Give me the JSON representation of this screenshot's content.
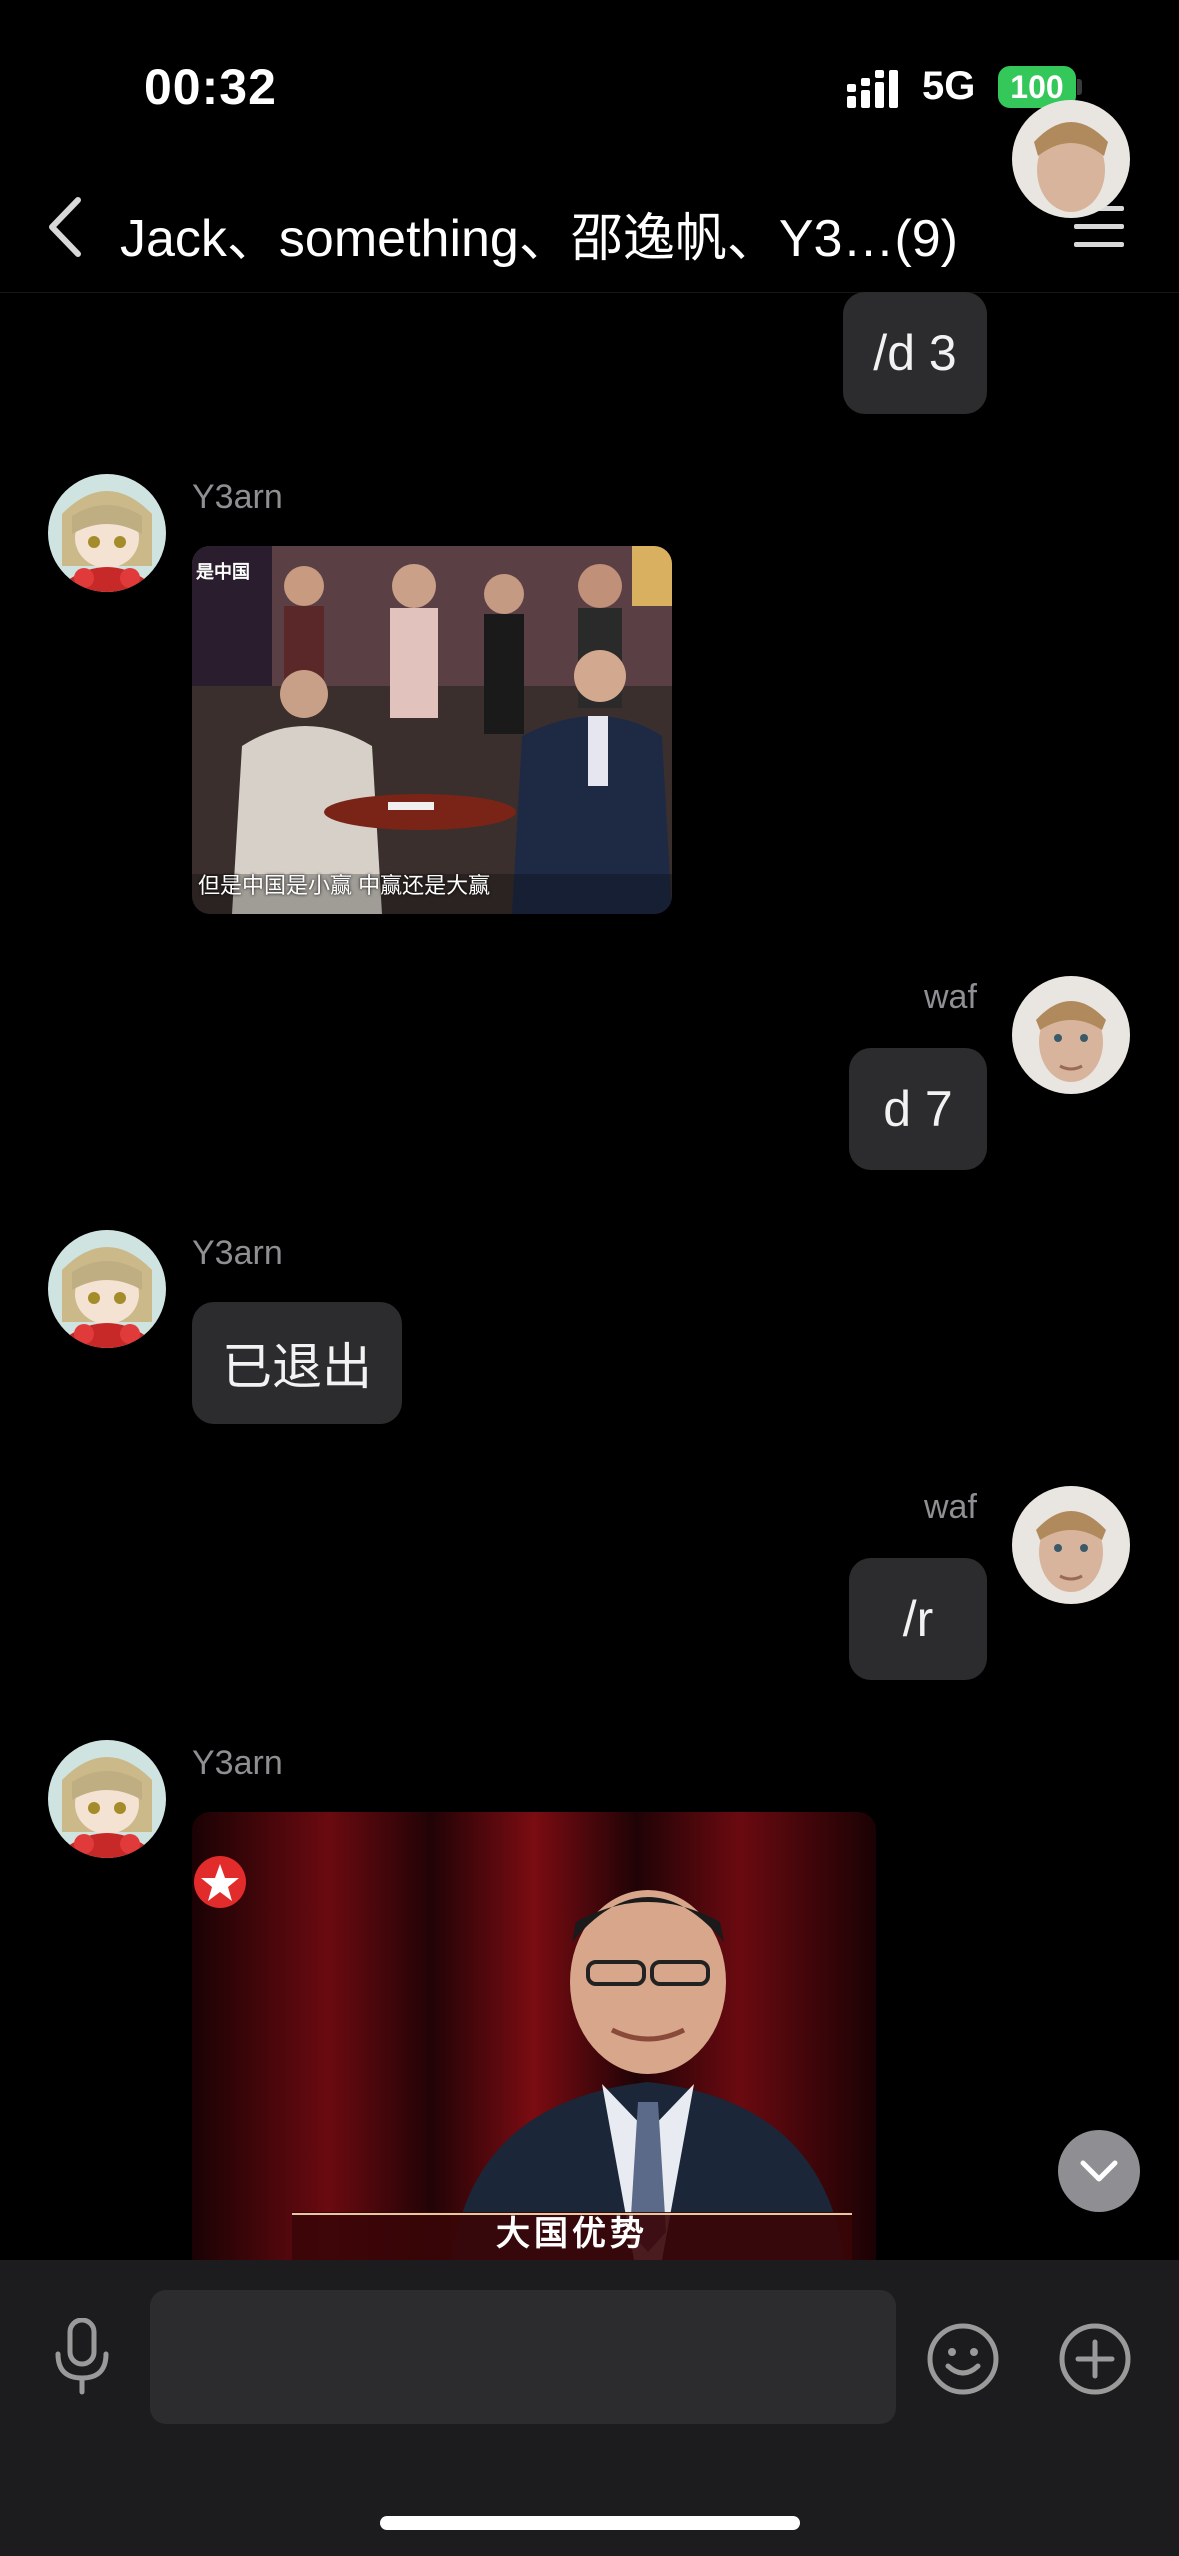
{
  "status_bar": {
    "time": "00:32",
    "network": "5G",
    "battery": "100"
  },
  "nav": {
    "title": "Jack、something、邵逸帆、Y3…(9)"
  },
  "messages": [
    {
      "side": "right",
      "sender": "",
      "text": "/d 3"
    },
    {
      "side": "left",
      "sender": "Y3arn",
      "image": "tv-talk-show-frame",
      "caption": "但是中国是小赢 中赢还是大赢"
    },
    {
      "side": "right",
      "sender": "waf",
      "text": "d 7"
    },
    {
      "side": "left",
      "sender": "Y3arn",
      "text": "已退出"
    },
    {
      "side": "right",
      "sender": "waf",
      "text": "/r"
    },
    {
      "side": "left",
      "sender": "Y3arn",
      "image": "speaker-on-stage",
      "caption": "大国优势"
    }
  ],
  "input": {
    "placeholder": ""
  },
  "colors": {
    "accent_green": "#34c759",
    "bubble": "#2c2c2e",
    "background": "#000000",
    "input_bar": "#1c1c1e"
  },
  "icons": [
    "chevron-left-icon",
    "menu-icon",
    "microphone-icon",
    "emoji-icon",
    "plus-circle-icon",
    "chevron-down-icon"
  ]
}
